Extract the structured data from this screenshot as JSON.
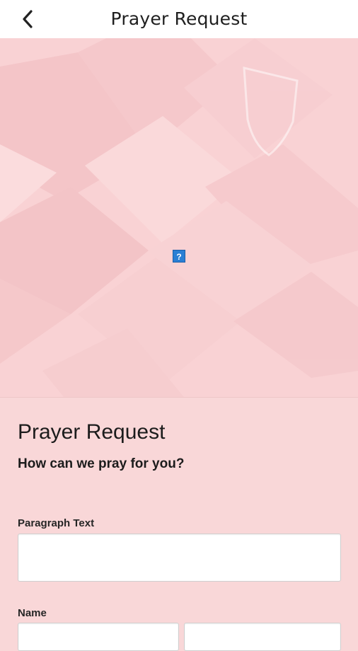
{
  "header": {
    "title": "Prayer Request",
    "back_icon": "chevron-left-icon"
  },
  "hero": {
    "broken_image_glyph": "?"
  },
  "form": {
    "title": "Prayer Request",
    "subtitle": "How can we pray for you?",
    "fields": [
      {
        "label": "Paragraph Text",
        "value": ""
      },
      {
        "label": "Name",
        "first_value": "",
        "last_value": ""
      }
    ]
  },
  "colors": {
    "background": "#f9d7d8",
    "header_background": "#ffffff"
  }
}
